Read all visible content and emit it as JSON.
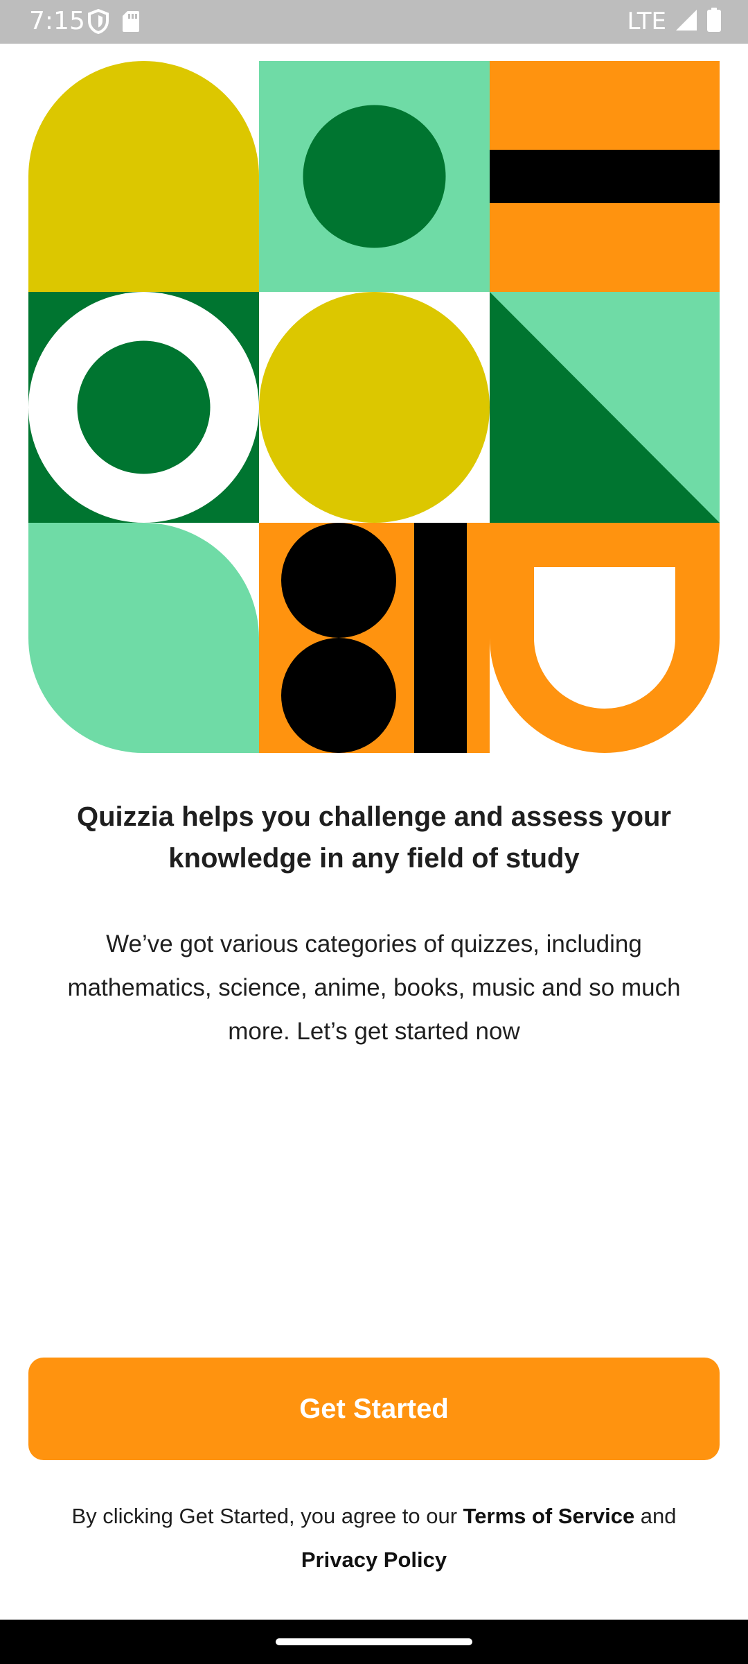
{
  "status_bar": {
    "time": "7:15",
    "network": "LTE",
    "icons": [
      "shield-icon",
      "sd-card-icon",
      "signal-icon",
      "battery-icon"
    ]
  },
  "illustration": {
    "colors": {
      "yellow": "#dcc700",
      "mint": "#6fdba6",
      "green": "#007530",
      "orange": "#ff930f",
      "black": "#000000",
      "white": "#ffffff"
    }
  },
  "onboarding": {
    "headline": "Quizzia helps you challenge and assess your knowledge in any field of study",
    "description": "We’ve got various categories of quizzes, including mathematics, science, anime, books, music and so much more. Let’s get started now"
  },
  "cta": {
    "label": "Get Started",
    "color": "#ff930f"
  },
  "legal": {
    "prefix": "By clicking Get Started, you agree to our ",
    "terms_label": "Terms of Service",
    "conjunction": " and",
    "privacy_label": "Privacy Policy"
  }
}
